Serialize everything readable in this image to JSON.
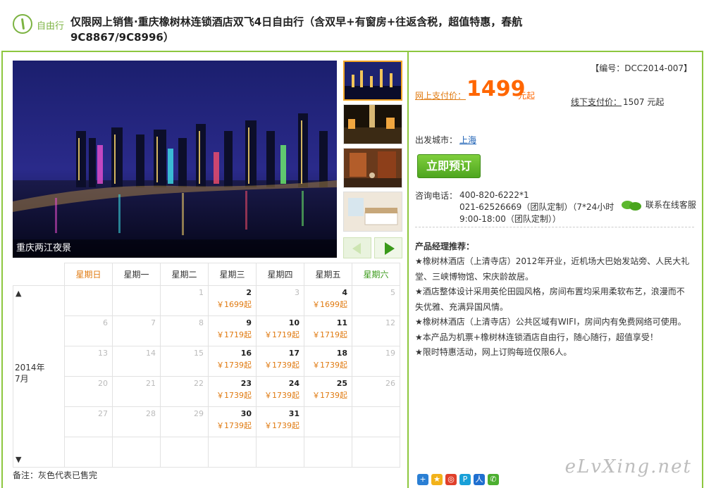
{
  "header": {
    "tag_label": "自由行",
    "title": "仅限网上销售·重庆橡树林连锁酒店双飞4日自由行（含双早+有窗房+往返含税，超值特惠，春航9C8867/9C8996）"
  },
  "gallery": {
    "caption": "重庆两江夜景",
    "thumbs": [
      "thumb-night-city",
      "thumb-street",
      "thumb-old-town",
      "thumb-hotel-room"
    ]
  },
  "calendar": {
    "weekdays": [
      "星期日",
      "星期一",
      "星期二",
      "星期三",
      "星期四",
      "星期五",
      "星期六"
    ],
    "year_label": "2014年",
    "month_label": "7月",
    "up_arrow": "▲",
    "down_arrow": "▼",
    "weeks": [
      [
        {
          "d": ""
        },
        {
          "d": ""
        },
        {
          "d": "1"
        },
        {
          "d": "2",
          "p": "￥1699起"
        },
        {
          "d": "3"
        },
        {
          "d": "4",
          "p": "￥1699起"
        },
        {
          "d": "5"
        }
      ],
      [
        {
          "d": "6"
        },
        {
          "d": "7"
        },
        {
          "d": "8"
        },
        {
          "d": "9",
          "p": "￥1719起"
        },
        {
          "d": "10",
          "p": "￥1719起"
        },
        {
          "d": "11",
          "p": "￥1719起"
        },
        {
          "d": "12"
        }
      ],
      [
        {
          "d": "13"
        },
        {
          "d": "14"
        },
        {
          "d": "15"
        },
        {
          "d": "16",
          "p": "￥1739起"
        },
        {
          "d": "17",
          "p": "￥1739起"
        },
        {
          "d": "18",
          "p": "￥1739起"
        },
        {
          "d": "19"
        }
      ],
      [
        {
          "d": "20"
        },
        {
          "d": "21"
        },
        {
          "d": "22"
        },
        {
          "d": "23",
          "p": "￥1739起"
        },
        {
          "d": "24",
          "p": "￥1739起"
        },
        {
          "d": "25",
          "p": "￥1739起"
        },
        {
          "d": "26"
        }
      ],
      [
        {
          "d": "27"
        },
        {
          "d": "28"
        },
        {
          "d": "29"
        },
        {
          "d": "30",
          "p": "￥1739起"
        },
        {
          "d": "31",
          "p": "￥1739起"
        },
        {
          "d": ""
        },
        {
          "d": ""
        }
      ],
      [
        {
          "d": ""
        },
        {
          "d": ""
        },
        {
          "d": ""
        },
        {
          "d": ""
        },
        {
          "d": ""
        },
        {
          "d": ""
        },
        {
          "d": ""
        }
      ]
    ],
    "note": "备注：灰色代表已售完"
  },
  "product": {
    "code": "【编号：DCC2014-007】",
    "online_label": "网上支付价：",
    "online_price": "1499",
    "price_unit": "元起",
    "offline_label": "线下支付价：",
    "offline_price": "1507 元起",
    "depart_label": "出发城市：",
    "depart_city": "上海",
    "book_label": "立即预订",
    "phone_label": "咨询电话：",
    "phone_lines": [
      "400-820-6222*1",
      "021-62526669（团队定制）（7*24小时",
      "9:00-18:00（团队定制））"
    ],
    "chat_label": "联系在线客服",
    "pm_title": "产品经理推荐：",
    "pm_items": [
      "★橡树林酒店（上清寺店）2012年开业，近机场大巴始发站旁、人民大礼堂、三峡博物馆、宋庆龄故居。",
      "★酒店整体设计采用英伦田园风格，房间布置均采用柔软布艺，浪漫而不失优雅、充满异国风情。",
      "★橡树林酒店（上清寺店）公共区域有WIFI，房间内有免费网络可使用。",
      "★本产品为机票+橡树林连锁酒店自由行，随心随行，超值享受！",
      "★限时特惠活动，网上订购每班仅限6人。"
    ]
  },
  "share": {
    "icons": [
      {
        "name": "share-plus-icon",
        "glyph": "+",
        "color": "#2a7fd4"
      },
      {
        "name": "share-qzone-icon",
        "glyph": "★",
        "color": "#f2b21a"
      },
      {
        "name": "share-weibo-icon",
        "glyph": "◎",
        "color": "#e0402b"
      },
      {
        "name": "share-pengyou-icon",
        "glyph": "P",
        "color": "#19a0d8"
      },
      {
        "name": "share-renren-icon",
        "glyph": "人",
        "color": "#1f6fd0"
      },
      {
        "name": "share-wechat-icon",
        "glyph": "✆",
        "color": "#4caf30"
      }
    ]
  },
  "watermark": "eLvXing.net"
}
